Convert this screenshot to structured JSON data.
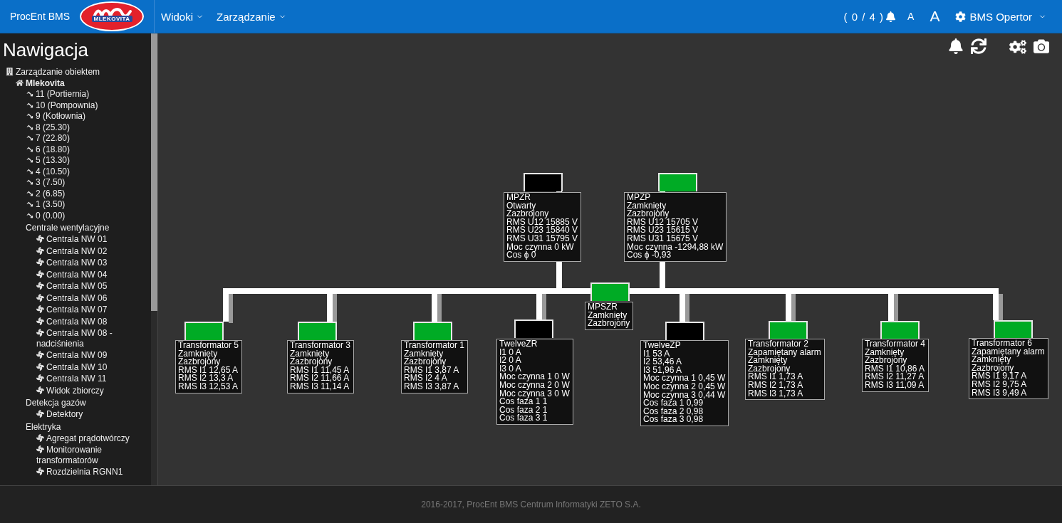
{
  "header": {
    "brand": "ProcEnt BMS",
    "logo_text": "MLEKOVITA",
    "menus": [
      {
        "label": "Widoki"
      },
      {
        "label": "Zarządzanie"
      }
    ],
    "alarm_count": "( 0 / 4 )",
    "font_small": "A",
    "font_large": "A",
    "user": "BMS Opertor"
  },
  "sidebar": {
    "title": "Nawigacja",
    "tree": [
      {
        "kind": "building",
        "label": "Zarządzanie obiektem",
        "children": [
          {
            "kind": "home",
            "label": "Mlekovita",
            "children": [
              {
                "kind": "floor",
                "label": "11 (Portiernia)"
              },
              {
                "kind": "floor",
                "label": "10 (Pompownia)"
              },
              {
                "kind": "floor",
                "label": "9 (Kotłownia)"
              },
              {
                "kind": "floor",
                "label": "8 (25.30)"
              },
              {
                "kind": "floor",
                "label": "7 (22.80)"
              },
              {
                "kind": "floor",
                "label": "6 (18.80)"
              },
              {
                "kind": "floor",
                "label": "5 (13.30)"
              },
              {
                "kind": "floor",
                "label": "4 (10.50)"
              },
              {
                "kind": "floor",
                "label": "3 (7.50)"
              },
              {
                "kind": "floor",
                "label": "2 (6.85)"
              },
              {
                "kind": "floor",
                "label": "1 (3.50)"
              },
              {
                "kind": "floor",
                "label": "0 (0.00)"
              },
              {
                "kind": "group",
                "label": "Centrale wentylacyjne",
                "children": [
                  {
                    "kind": "device",
                    "label": "Centrala NW 01"
                  },
                  {
                    "kind": "device",
                    "label": "Centrala NW 02"
                  },
                  {
                    "kind": "device",
                    "label": "Centrala NW 03"
                  },
                  {
                    "kind": "device",
                    "label": "Centrala NW 04"
                  },
                  {
                    "kind": "device",
                    "label": "Centrala NW 05"
                  },
                  {
                    "kind": "device",
                    "label": "Centrala NW 06"
                  },
                  {
                    "kind": "device",
                    "label": "Centrala NW 07"
                  },
                  {
                    "kind": "device",
                    "label": "Centrala NW 08"
                  },
                  {
                    "kind": "device",
                    "label": "Centrala NW 08 - nadciśnienia"
                  },
                  {
                    "kind": "device",
                    "label": "Centrala NW 09"
                  },
                  {
                    "kind": "device",
                    "label": "Centrala NW 10"
                  },
                  {
                    "kind": "device",
                    "label": "Centrala NW 11"
                  },
                  {
                    "kind": "device",
                    "label": "Widok zbiorczy"
                  }
                ]
              },
              {
                "kind": "group",
                "label": "Detekcja gazów",
                "children": [
                  {
                    "kind": "device",
                    "label": "Detektory"
                  }
                ]
              },
              {
                "kind": "group",
                "label": "Elektryka",
                "children": [
                  {
                    "kind": "device",
                    "label": "Agregat prądotwórczy"
                  },
                  {
                    "kind": "device",
                    "label": "Monitorowanie transformatorów"
                  },
                  {
                    "kind": "device",
                    "label": "Rozdzielnia RGNN1"
                  }
                ]
              }
            ]
          }
        ]
      }
    ]
  },
  "diagram": {
    "nodes": [
      {
        "closed": false,
        "lines": [
          "MPZR",
          "Otwarty",
          "Zazbrojony",
          "RMS U12 15885 V",
          "RMS U23 15840 V",
          "RMS U31 15795 V",
          "Moc czynna 0 kW",
          "Cos ϕ 0"
        ]
      },
      {
        "closed": true,
        "lines": [
          "MPZP",
          "Zamknięty",
          "Zazbrojony",
          "RMS U12 15705 V",
          "RMS U23 15615 V",
          "RMS U31 15675 V",
          "Moc czynna -1294,88 kW",
          "Cos ϕ -0,93"
        ]
      },
      {
        "closed": true,
        "lines": [
          "MPSZR",
          "Zamknięty",
          "Zazbrojony"
        ]
      },
      {
        "closed": true,
        "lines": [
          "Transformator 5",
          "Zamknięty",
          "Zazbrojony",
          "RMS I1 12,65 A",
          "RMS I2 13,3 A",
          "RMS I3 12,53 A"
        ]
      },
      {
        "closed": true,
        "lines": [
          "Transformator 3",
          "Zamknięty",
          "Zazbrojony",
          "RMS I1 11,45 A",
          "RMS I2 11,66 A",
          "RMS I3 11,14 A"
        ]
      },
      {
        "closed": true,
        "lines": [
          "Transformator 1",
          "Zamknięty",
          "Zazbrojony",
          "RMS I1 3,87 A",
          "RMS I2 4 A",
          "RMS I3 3,87 A"
        ]
      },
      {
        "closed": false,
        "lines": [
          "TwelveZR",
          "I1 0 A",
          "I2 0 A",
          "I3 0 A",
          "Moc czynna 1 0 W",
          "Moc czynna 2 0 W",
          "Moc czynna 3 0 W",
          "Cos faza 1 1",
          "Cos faza 2 1",
          "Cos faza 3 1"
        ]
      },
      {
        "closed": false,
        "lines": [
          "TwelveZP",
          "I1 53 A",
          "I2 53,46 A",
          "I3 51,96 A",
          "Moc czynna 1 0,45 W",
          "Moc czynna 2 0,45 W",
          "Moc czynna 3 0,44 W",
          "Cos faza 1 0,99",
          "Cos faza 2 0,98",
          "Cos faza 3 0,98"
        ]
      },
      {
        "closed": true,
        "lines": [
          "Transformator 2",
          "Zapamiętany alarm",
          "Zamknięty",
          "Zazbrojony",
          "RMS I1 1,73 A",
          "RMS I2 1,73 A",
          "RMS I3 1,73 A"
        ]
      },
      {
        "closed": true,
        "lines": [
          "Transformator 4",
          "Zamknięty",
          "Zazbrojony",
          "RMS I1 10,86 A",
          "RMS I2 11,27 A",
          "RMS I3 11,09 A"
        ]
      },
      {
        "closed": true,
        "lines": [
          "Transformator 6",
          "Zapamiętany alarm",
          "Zamknięty",
          "Zazbrojony",
          "RMS I1 9,17 A",
          "RMS I2 9,75 A",
          "RMS I3 9,49 A"
        ]
      }
    ]
  },
  "footer": "2016-2017, ProcEnt BMS Centrum Informatyki ZETO S.A."
}
